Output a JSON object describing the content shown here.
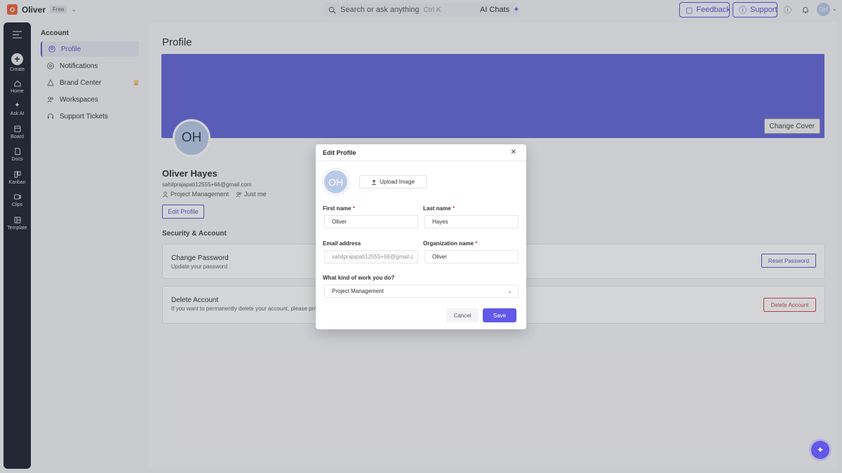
{
  "workspace": {
    "initial": "O",
    "name": "Oliver",
    "plan": "Free"
  },
  "search": {
    "placeholder": "Search or ask anything",
    "shortcut": "Ctrl K"
  },
  "ai_chats": "AI Chats",
  "top_buttons": {
    "feedback": "Feedback",
    "support": "Support"
  },
  "user_initials": "OH",
  "rail": {
    "items": [
      {
        "label": "Create",
        "icon": "plus-icon"
      },
      {
        "label": "Home",
        "icon": "home-icon"
      },
      {
        "label": "Ask AI",
        "icon": "sparkle-icon"
      },
      {
        "label": "Board",
        "icon": "board-icon"
      },
      {
        "label": "Docs",
        "icon": "doc-icon"
      },
      {
        "label": "Kanban",
        "icon": "kanban-icon"
      },
      {
        "label": "Clips",
        "icon": "clips-icon"
      },
      {
        "label": "Template",
        "icon": "template-icon"
      }
    ]
  },
  "sidebar": {
    "title": "Account",
    "items": [
      {
        "label": "Profile",
        "icon": "user-circle-icon"
      },
      {
        "label": "Notifications",
        "icon": "bell-icon"
      },
      {
        "label": "Brand Center",
        "icon": "brand-icon"
      },
      {
        "label": "Workspaces",
        "icon": "users-icon"
      },
      {
        "label": "Support Tickets",
        "icon": "headset-icon"
      }
    ]
  },
  "profile": {
    "page_title": "Profile",
    "change_cover": "Change Cover",
    "initials": "OH",
    "name": "Oliver Hayes",
    "email": "sahilprajapati12555+66@gmail.com",
    "role": "Project Management",
    "audience": "Just me",
    "edit_button": "Edit Profile",
    "cover_color": "#6366d9"
  },
  "security": {
    "title": "Security & Account",
    "change_password": {
      "title": "Change Password",
      "subtitle": "Update your password",
      "button": "Reset Password"
    },
    "delete_account": {
      "title": "Delete Account",
      "subtitle": "If you want to permanently delete your account, please pro",
      "button": "Delete Account"
    }
  },
  "modal": {
    "title": "Edit Profile",
    "initials": "OH",
    "upload": "Upload Image",
    "first_name_label": "First name",
    "last_name_label": "Last name",
    "email_label": "Email address",
    "org_label": "Organization name",
    "work_label": "What kind of work you do?",
    "first_name": "Oliver",
    "last_name": "Hayes",
    "email": "sahilprajapati12555+66@gmail.c",
    "org": "Oliver",
    "work": "Project Management",
    "required_mark": "*",
    "cancel": "Cancel",
    "save": "Save"
  },
  "accent": "#6259e8"
}
